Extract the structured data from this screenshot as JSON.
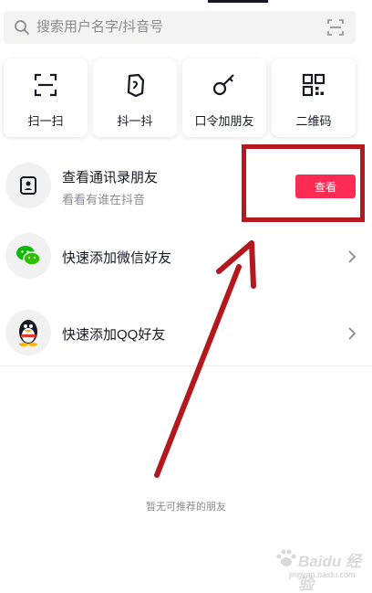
{
  "search": {
    "placeholder": "搜索用户名字/抖音号"
  },
  "quick_actions": [
    {
      "label": "扫一扫",
      "icon": "scan-icon"
    },
    {
      "label": "抖一抖",
      "icon": "shake-icon"
    },
    {
      "label": "口令加朋友",
      "icon": "key-icon"
    },
    {
      "label": "二维码",
      "icon": "qr-code-icon"
    }
  ],
  "contacts": {
    "title": "查看通讯录朋友",
    "subtitle": "看看有谁在抖音",
    "button_label": "查看"
  },
  "wechat": {
    "title": "快速添加微信好友"
  },
  "qq": {
    "title": "快速添加QQ好友"
  },
  "empty_state": "暂无可推荐的朋友",
  "watermark": {
    "text": "Baidu 经验",
    "url": "jingyan.baidu.com"
  },
  "colors": {
    "accent": "#fe2c55",
    "annotation": "#b4181d",
    "wechat": "#09bb07"
  }
}
